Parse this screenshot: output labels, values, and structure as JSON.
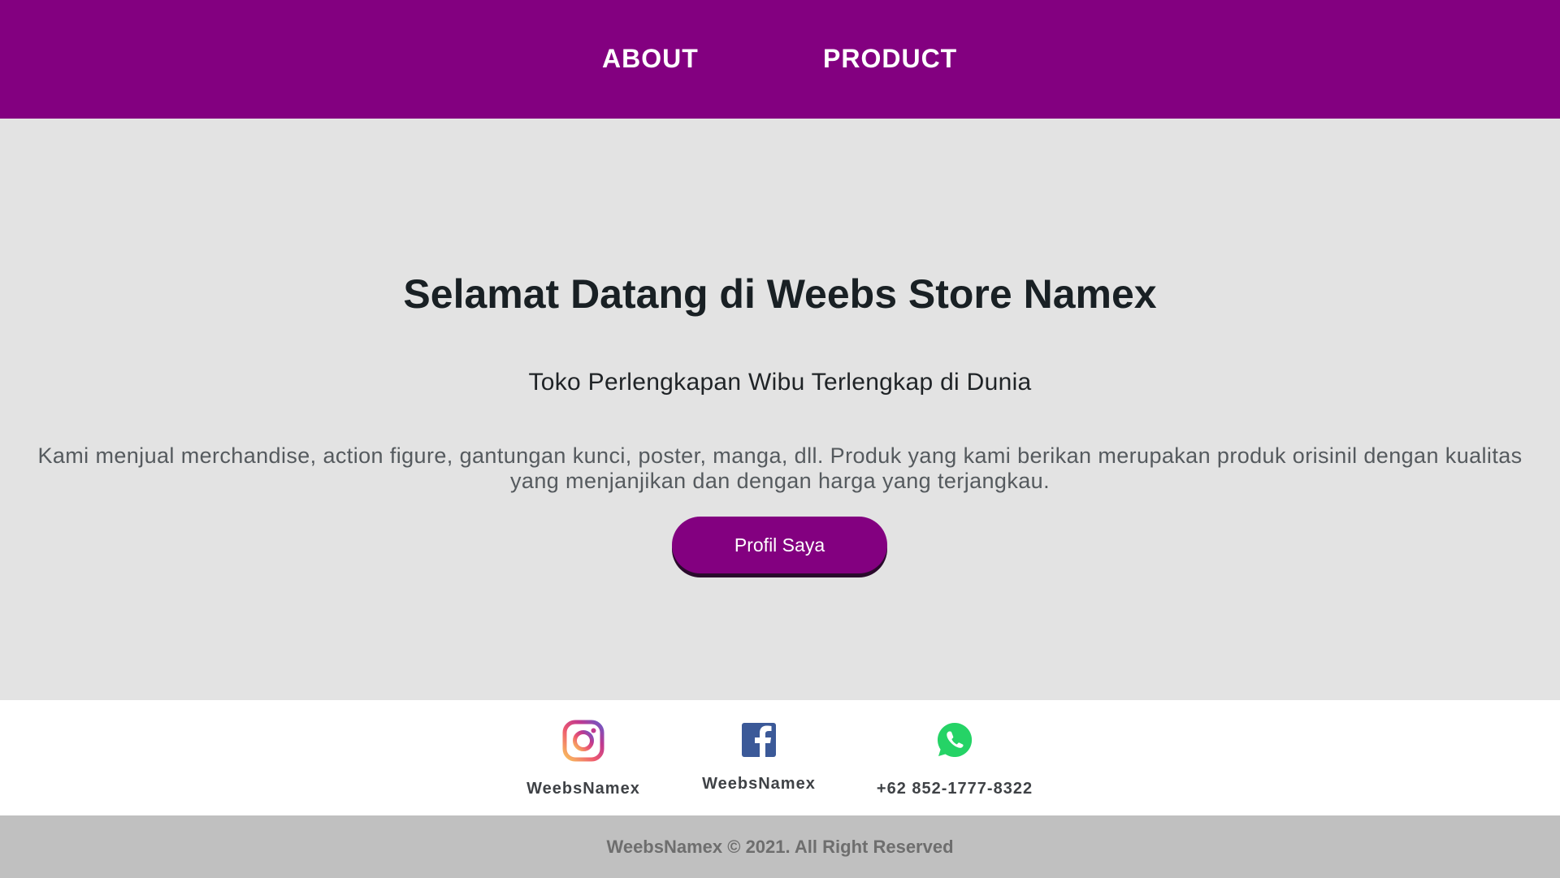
{
  "nav": {
    "items": [
      {
        "label": "ABOUT"
      },
      {
        "label": "PRODUCT"
      }
    ],
    "background_color": "#830080"
  },
  "hero": {
    "title": "Selamat Datang di Weebs Store Namex",
    "subtitle": "Toko Perlengkapan Wibu Terlengkap di Dunia",
    "description": "Kami menjual merchandise, action figure, gantungan kunci, poster, manga, dll. Produk yang kami berikan merupakan produk orisinil dengan kualitas yang menjanjikan dan dengan harga yang terjangkau.",
    "button_label": "Profil Saya"
  },
  "contact": {
    "instagram": {
      "icon": "instagram-icon",
      "label": "WeebsNamex"
    },
    "facebook": {
      "icon": "facebook-icon",
      "label": "WeebsNamex"
    },
    "whatsapp": {
      "icon": "whatsapp-icon",
      "label": "+62 852-1777-8322"
    }
  },
  "footer": {
    "text": "WeebsNamex © 2021. All Right Reserved"
  }
}
